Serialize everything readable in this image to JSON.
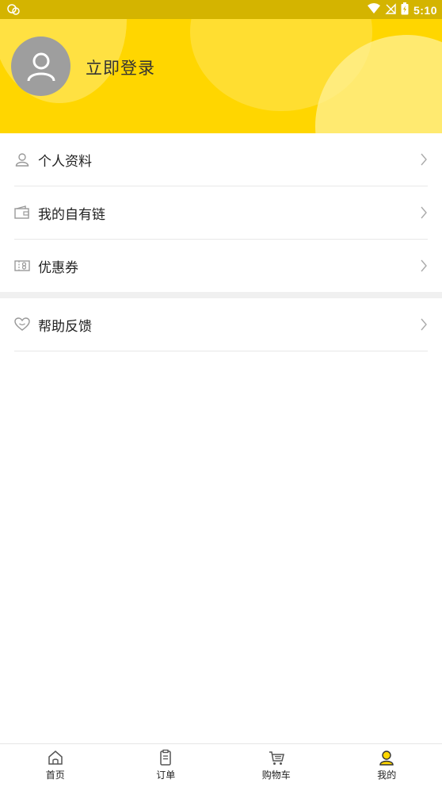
{
  "status_bar": {
    "time": "5:10",
    "icons": [
      "notification-icon",
      "wifi-icon",
      "signal-off-icon",
      "battery-charging-icon"
    ]
  },
  "profile": {
    "login_label": "立即登录",
    "avatar_icon": "user-avatar-icon"
  },
  "menu": {
    "items": [
      {
        "label": "个人资料",
        "icon": "person-icon"
      },
      {
        "label": "我的自有链",
        "icon": "wallet-icon"
      },
      {
        "label": "优惠券",
        "icon": "coupon-icon"
      },
      {
        "label": "帮助反馈",
        "icon": "heart-help-icon"
      }
    ]
  },
  "tabbar": {
    "items": [
      {
        "label": "首页",
        "icon": "home-icon",
        "active": false
      },
      {
        "label": "订单",
        "icon": "order-icon",
        "active": false
      },
      {
        "label": "购物车",
        "icon": "cart-icon",
        "active": false
      },
      {
        "label": "我的",
        "icon": "profile-icon",
        "active": true
      }
    ]
  },
  "colors": {
    "accent": "#ffd600",
    "status_bar": "#d4b400",
    "avatar": "#9e9e9e"
  }
}
